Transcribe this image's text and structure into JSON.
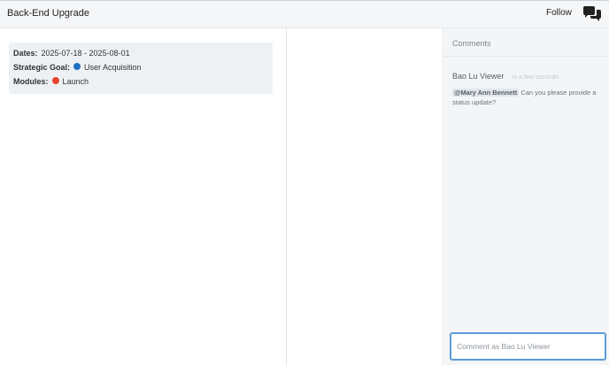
{
  "header": {
    "title": "Back-End Upgrade",
    "follow_label": "Follow",
    "chat_icon": "chat-bubbles-icon"
  },
  "details": {
    "dates_label": "Dates:",
    "dates_value": "2025-07-18 - 2025-08-01",
    "goal_label": "Strategic Goal:",
    "goal_value": "User Acquisition",
    "goal_color": "#1f6fbf",
    "modules_label": "Modules:",
    "modules_value": "Launch",
    "modules_color": "#e8452c"
  },
  "comments": {
    "title": "Comments",
    "items": [
      {
        "author": "Bao Lu Viewer",
        "time": "in a few seconds",
        "mention": "@Mary Ann Bennett",
        "text": "Can you please provide a status update?"
      }
    ],
    "input_placeholder": "Comment as Bao Lu Viewer"
  }
}
